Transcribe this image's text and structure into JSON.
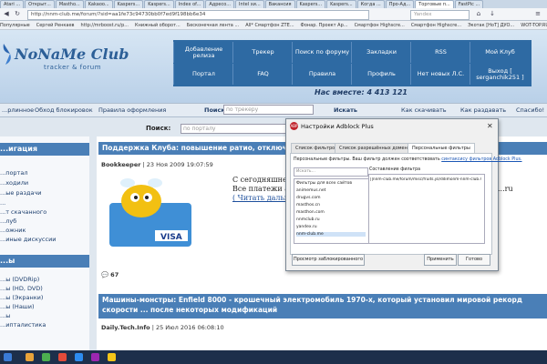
{
  "browser": {
    "tabs": [
      "Atari ...",
      "Открыт...",
      "Mastho...",
      "Kakaoo...",
      "Kaspers...",
      "Kaspers...",
      "Index of...",
      "Адресо...",
      "Intel хи...",
      "Вакансия",
      "Kaspers...",
      "Kaspers...",
      "Когда ...",
      "Про-Ад...",
      "Торговые п...",
      "FastPic ..."
    ],
    "url": "http://nnm-club.me/forum/?sid=aa1fe73c94730bb0f7ed9f198bb6e34",
    "search_placeholder": "Yandex",
    "bookmarks": [
      "Популярные",
      "Сергей Ренкаев",
      "http://mrboost.ru/p...",
      "Книжный оборот...",
      "Бесконечная лента ...",
      "All* Смартфон ZTE...",
      "Фонар. Проект Ар...",
      "Смартфон Highscre...",
      "Смартфон Highscre...",
      "Экотак [НоТ] ДУО...",
      "WOT-TOP.RU офиц...",
      "3.2.ретр Вакансии",
      "Mother-Fa-Bear"
    ]
  },
  "site": {
    "logo": "NoNaMe Club",
    "logo_sub": "tracker & forum",
    "nav": [
      [
        "Добавление релиза",
        "Трекер",
        "Поиск по форуму",
        "Закладки",
        "RSS",
        "Мой Клуб"
      ],
      [
        "Портал",
        "FAQ",
        "Правила",
        "Профиль",
        "Нет новых Л.С.",
        "Выход [ serganchik251 ]"
      ]
    ],
    "online": "Нас вместе: 4 413 121",
    "subnav": [
      "...рлинное",
      "Обход блокировок",
      "Правила оформления"
    ],
    "tracker_search_label": "Поиск:",
    "tracker_search_placeholder": "по трекеру",
    "tracker_search_button": "Искать",
    "subnav_right": [
      "Как скачивать",
      "Как раздавать",
      "Спасибо!"
    ],
    "portal_search_label": "Поиск:",
    "portal_search_placeholder": "по порталу",
    "portal_search_button": "Искать"
  },
  "sidebar": {
    "head1": "...игация",
    "items1": [
      "...портал",
      "...ходили",
      "...ые раздачи",
      "...",
      "...т скачанного",
      "...луб",
      "...ожник",
      "...иные дискуссии"
    ],
    "head2": "...ы",
    "items2": [
      "...ы (DVDRip)",
      "...ы (HD, DVD)",
      "...ы (Экранки)",
      "...ы (Наши)",
      "...ы",
      "...ипталистика"
    ]
  },
  "news": [
    {
      "title": "Поддержка Клуба: повышение ратио, отключение ...",
      "author": "Bookkeeper",
      "date": "23 Ноя 2009 19:07:59",
      "line1": "С сегодняшнего д...",
      "line2": "Все платежи автом...",
      "more": "( Читать дальше ...",
      "suffix": "...ru",
      "comments": "67"
    },
    {
      "title": "Машины-монстры: Enfield 8000 - крошечный электромобиль 1970-х, который установил мировой рекорд скорости ... после некоторых модификаций",
      "author": "Daily.Tech.Info",
      "date": "25 Июл 2016 06:08:10"
    }
  ],
  "dialog": {
    "title": "Настройки Adblock Plus",
    "tabs": [
      "Список фильтров",
      "Список разрешённых доменов",
      "Персональные фильтры"
    ],
    "description": "Персональные фильтры. Ваш фильтр должен соответствовать",
    "description_link": "синтаксису фильтров Adblock Plus.",
    "filter_placeholder": "Искать...",
    "sites": [
      "Фильтры для всех сайтов",
      "animemus.net",
      "drugvs.com",
      "masthos.cn",
      "masthon.com",
      "nnmclub.ru",
      "yandex.ru",
      "nnm-club.me"
    ],
    "rule_label": "Составление фильтра",
    "rule": "||nnm-club.me/forum/misc/fruits.jsl/ddimonm-nnm-club.me/w",
    "buttons": [
      "Просмотр заблокированного",
      "Применить",
      "Готово"
    ]
  },
  "colors": {
    "accent": "#2e6aa3",
    "header": "#4a7fb7"
  }
}
